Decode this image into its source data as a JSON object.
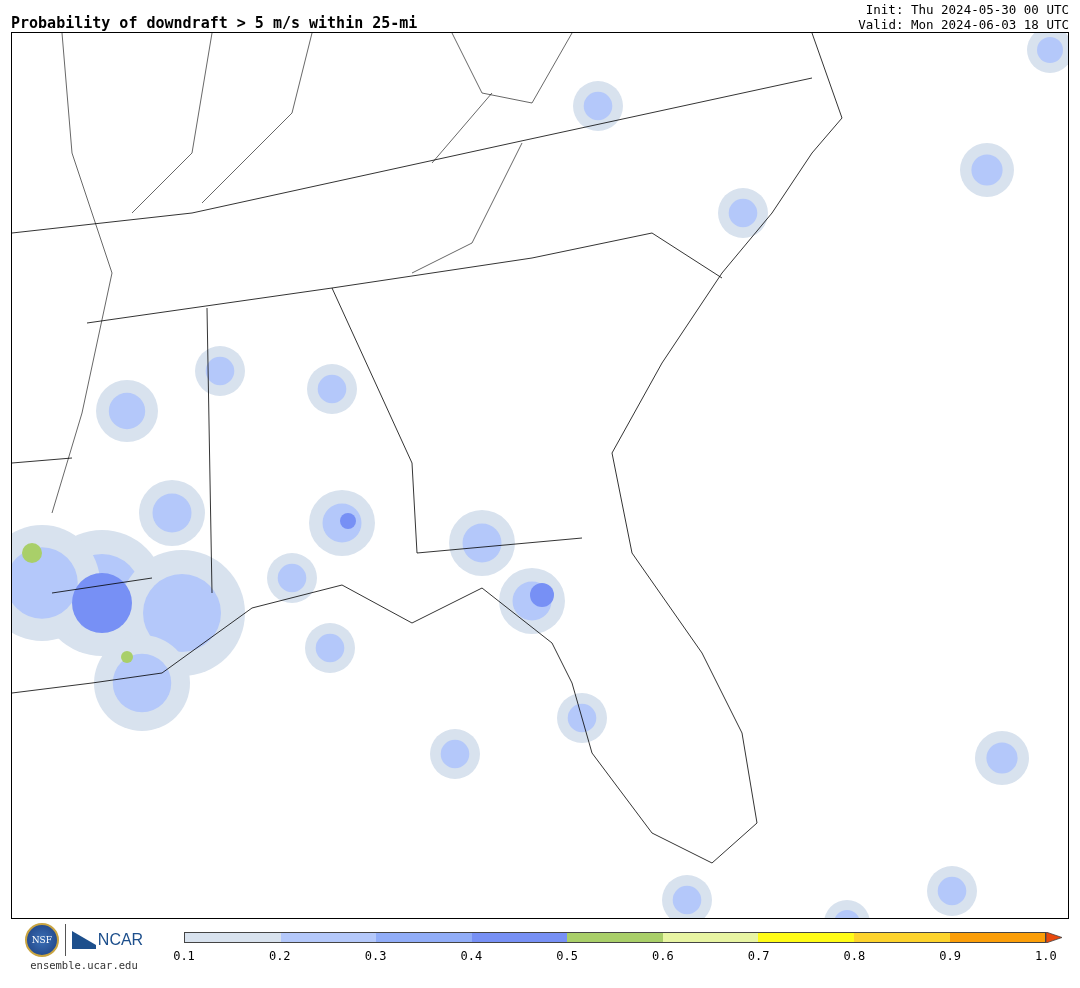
{
  "title": "Probability of downdraft > 5 m/s within 25-mi",
  "init": "Init: Thu 2024-05-30 00 UTC",
  "valid": "Valid: Mon 2024-06-03 18 UTC",
  "logos": {
    "nsf": "NSF",
    "ncar": "NCAR",
    "site": "ensemble.ucar.edu"
  },
  "colorbar": {
    "bins": [
      {
        "color": "#d8e2ee"
      },
      {
        "color": "#b4c8fa"
      },
      {
        "color": "#91adf8"
      },
      {
        "color": "#7790f5"
      },
      {
        "color": "#a9cf69"
      },
      {
        "color": "#e8f5a3"
      },
      {
        "color": "#fffc17"
      },
      {
        "color": "#fdd32c"
      },
      {
        "color": "#fb9e08"
      }
    ],
    "end": {
      "color": "#e8480c"
    },
    "ticks": [
      "0.1",
      "0.2",
      "0.3",
      "0.4",
      "0.5",
      "0.6",
      "0.7",
      "0.8",
      "0.9",
      "1.0"
    ]
  }
}
